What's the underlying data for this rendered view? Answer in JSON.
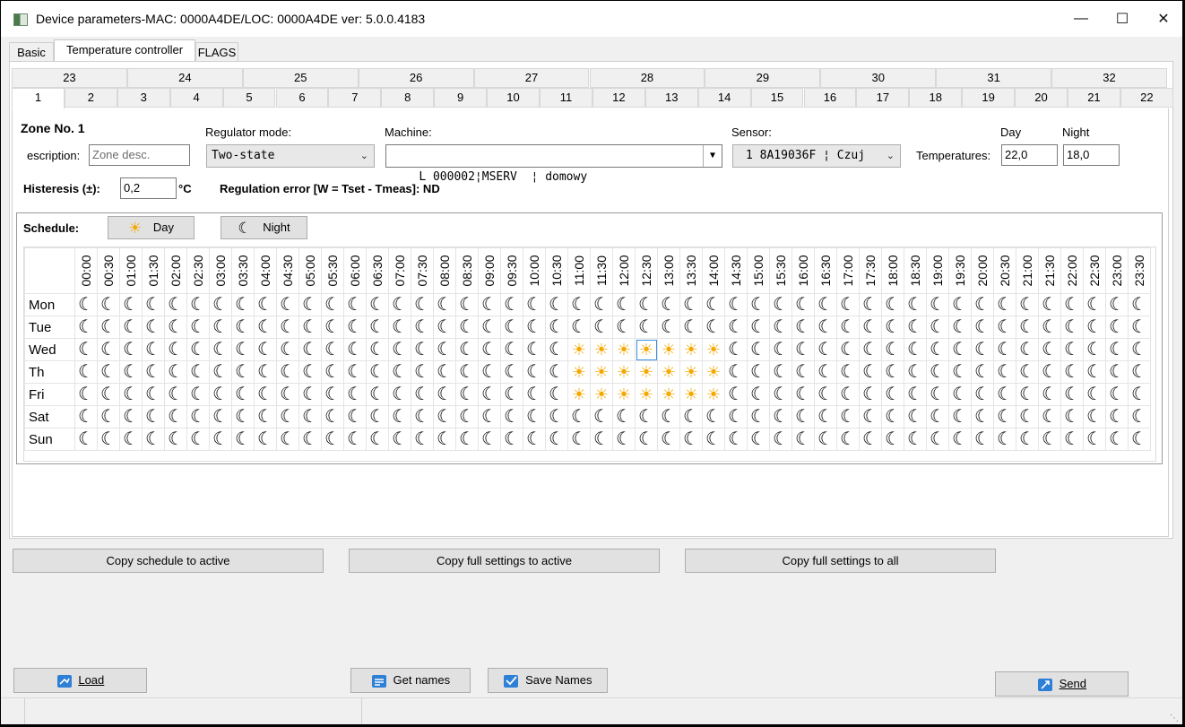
{
  "window": {
    "title": "Device parameters-MAC: 0000A4DE/LOC: 0000A4DE ver: 5.0.0.4183",
    "minimize": "—",
    "maximize": "☐",
    "close": "✕"
  },
  "tabs": [
    "Basic",
    "Temperature controller",
    "FLAGS"
  ],
  "zone_tabs_top": [
    "23",
    "24",
    "25",
    "26",
    "27",
    "28",
    "29",
    "30",
    "31",
    "32"
  ],
  "zone_tabs_bottom": [
    "1",
    "2",
    "3",
    "4",
    "5",
    "6",
    "7",
    "8",
    "9",
    "10",
    "11",
    "12",
    "13",
    "14",
    "15",
    "16",
    "17",
    "18",
    "19",
    "20",
    "21",
    "22"
  ],
  "zone": {
    "title": "Zone No. 1",
    "description_label": "escription:",
    "description_placeholder": "Zone desc.",
    "regulator_label": "Regulator mode:",
    "regulator_value": "Two-state",
    "machine_label": "Machine:",
    "machine_value": "L 000002¦MSERV  ¦ domowy",
    "sensor_label": "Sensor:",
    "sensor_value": "1 8A19036F ¦ Czuj",
    "day_label": "Day",
    "night_label": "Night",
    "temperatures_label": "Temperatures:",
    "day_temp": "22,0",
    "night_temp": "18,0",
    "histeresis_label": "Histeresis (±):",
    "histeresis_value": "0,2",
    "histeresis_unit": "°C",
    "regulation_error": "Regulation error [W = Tset - Tmeas]: ND"
  },
  "schedule": {
    "label": "Schedule:",
    "day_button": "Day",
    "night_button": "Night",
    "times": [
      "00:00",
      "00:30",
      "01:00",
      "01:30",
      "02:00",
      "02:30",
      "03:00",
      "03:30",
      "04:00",
      "04:30",
      "05:00",
      "05:30",
      "06:00",
      "06:30",
      "07:00",
      "07:30",
      "08:00",
      "08:30",
      "09:00",
      "09:30",
      "10:00",
      "10:30",
      "11:00",
      "11:30",
      "12:00",
      "12:30",
      "13:00",
      "13:30",
      "14:00",
      "14:30",
      "15:00",
      "15:30",
      "16:00",
      "16:30",
      "17:00",
      "17:30",
      "18:00",
      "18:30",
      "19:00",
      "19:30",
      "20:00",
      "20:30",
      "21:00",
      "21:30",
      "22:00",
      "22:30",
      "23:00",
      "23:30"
    ],
    "days": [
      "Mon",
      "Tue",
      "Wed",
      "Th",
      "Fri",
      "Sat",
      "Sun"
    ],
    "day_slots": {
      "Mon": [],
      "Tue": [],
      "Wed": [
        "11:00",
        "11:30",
        "12:00",
        "12:30",
        "13:00",
        "13:30",
        "14:00"
      ],
      "Th": [
        "11:00",
        "11:30",
        "12:00",
        "12:30",
        "13:00",
        "13:30",
        "14:00"
      ],
      "Fri": [
        "11:00",
        "11:30",
        "12:00",
        "12:30",
        "13:00",
        "13:30",
        "14:00"
      ],
      "Sat": [],
      "Sun": []
    },
    "selected_cell": {
      "day": "Wed",
      "time": "12:30"
    }
  },
  "copy_buttons": [
    "Copy schedule to active",
    "Copy full settings to active",
    "Copy full settings to all"
  ],
  "bottom_buttons": {
    "load": "Load",
    "get_names": "Get names",
    "save_names": "Save Names",
    "send": "Send"
  },
  "icons": {
    "sun": "sun-icon",
    "moon": "moon-icon"
  },
  "colors": {
    "sun": "#f5a800",
    "selection": "#3c8ede"
  }
}
